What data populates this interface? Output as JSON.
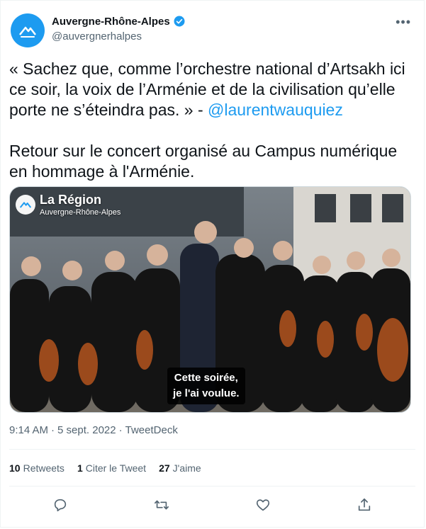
{
  "account": {
    "display_name": "Auvergne-Rhône-Alpes",
    "handle": "@auvergnerhalpes",
    "verified_icon": "verified-badge-icon",
    "avatar_color": "#1d9bf0"
  },
  "tweet": {
    "quote_part": "« Sachez que, comme l’orchestre national d’Artsakh ici ce soir, la voix de l’Arménie et de la civilisation qu’elle porte ne s’éteindra pas. » - ",
    "mention": "@laurentwauquiez",
    "second_paragraph": "Retour sur le concert organisé au Campus numérique en hommage à l'Arménie."
  },
  "media": {
    "logo_title": "La Région",
    "logo_subtitle": "Auvergne-Rhône-Alpes",
    "caption_line1": "Cette soirée,",
    "caption_line2": "je l'ai voulue."
  },
  "meta": {
    "time": "9:14 AM",
    "date": "5 sept. 2022",
    "source": "TweetDeck",
    "separator": "·"
  },
  "stats": {
    "retweets_count": "10",
    "retweets_label": "Retweets",
    "quotes_count": "1",
    "quotes_label": "Citer le Tweet",
    "likes_count": "27",
    "likes_label": "J'aime"
  },
  "actions": [
    "reply-icon",
    "retweet-icon",
    "like-icon",
    "share-icon"
  ],
  "colors": {
    "accent": "#1d9bf0",
    "secondary_text": "#536471",
    "border": "#eff3f4"
  }
}
